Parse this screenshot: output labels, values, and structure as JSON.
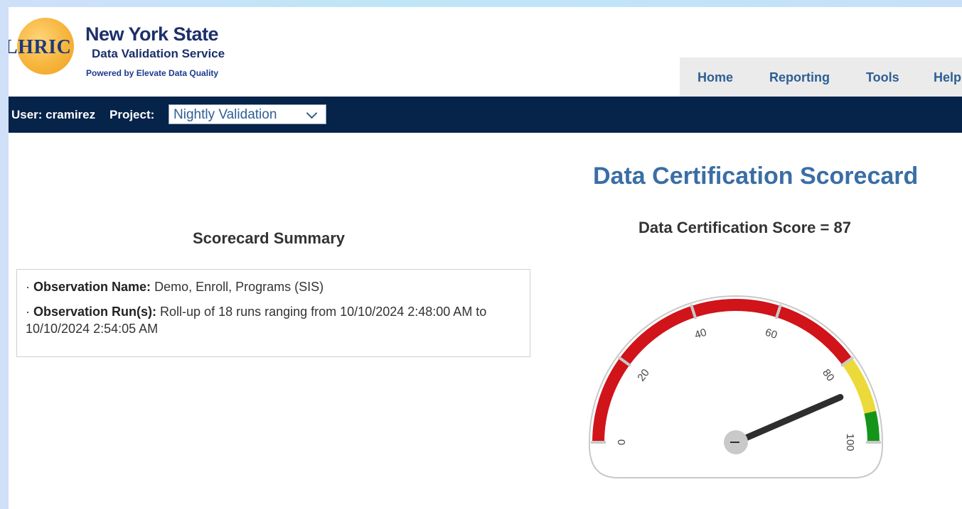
{
  "header": {
    "logo_text": "LHRIC",
    "title": "New York State",
    "subtitle": "Data Validation Service",
    "powered_by": "Powered by Elevate Data Quality"
  },
  "nav": {
    "items": [
      {
        "label": "Home"
      },
      {
        "label": "Reporting"
      },
      {
        "label": "Tools"
      },
      {
        "label": "Help"
      }
    ]
  },
  "userbar": {
    "user_text": "User: cramirez",
    "project_label": "Project:",
    "project_value": "Nightly Validation"
  },
  "summary": {
    "title": "Scorecard Summary",
    "items": [
      {
        "label": "Observation Name:",
        "value": "Demo, Enroll, Programs (SIS)"
      },
      {
        "label": "Observation Run(s):",
        "value": "Roll-up of 18 runs ranging from 10/10/2024 2:48:00 AM to 10/10/2024 2:54:05 AM"
      }
    ]
  },
  "scorecard": {
    "title": "Data Certification Scorecard",
    "score_text": "Data Certification Score = 87",
    "gauge": {
      "value": 87,
      "min": 0,
      "max": 100,
      "ticks": [
        "0",
        "20",
        "40",
        "60",
        "80",
        "100"
      ],
      "bands": [
        {
          "from": 0,
          "to": 80,
          "color": "#d0141a"
        },
        {
          "from": 80,
          "to": 93,
          "color": "#ecd93a"
        },
        {
          "from": 93,
          "to": 100,
          "color": "#14951a"
        }
      ]
    }
  },
  "colors": {
    "brand_dark": "#06234a",
    "accent_blue": "#3a6ea5",
    "nav_text": "#2e5f93"
  }
}
